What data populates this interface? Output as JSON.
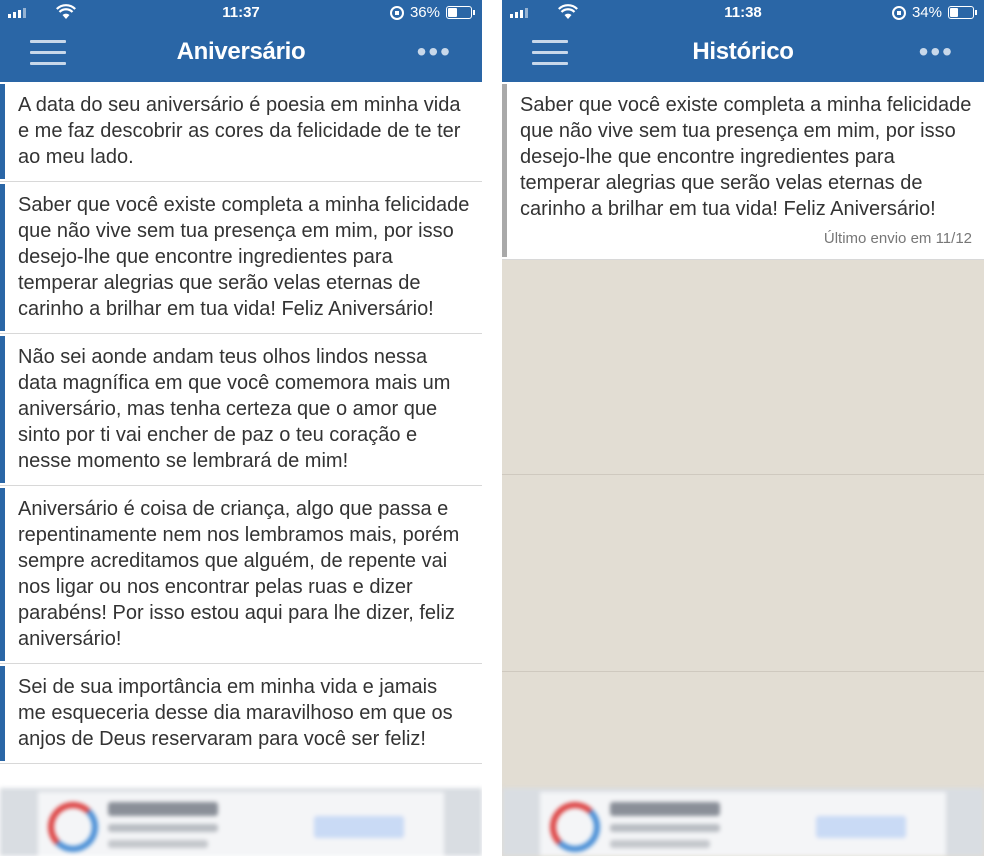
{
  "left": {
    "status": {
      "time": "11:37",
      "battery": "36%",
      "battery_level": 0.36
    },
    "title": "Aniversário",
    "messages": [
      "A data do seu aniversário é poesia em minha vida e me faz descobrir as cores da felicidade de te ter ao meu lado.",
      "Saber que você existe completa a minha felicidade que não vive sem tua presença em mim, por isso desejo-lhe que encontre ingredientes para temperar alegrias que serão velas eternas de carinho a brilhar em tua vida! Feliz Aniversário!",
      "Não sei aonde andam teus olhos lindos nessa data magnífica em que você comemora mais um aniversário, mas tenha certeza que o amor que sinto por ti vai encher de paz o teu coração e nesse momento se lembrará de mim!",
      "Aniversário é coisa de criança, algo que passa e repentinamente nem nos lembramos mais, porém sempre acreditamos que alguém, de repente vai nos ligar ou nos encontrar pelas ruas e dizer parabéns! Por isso estou aqui para lhe dizer, feliz aniversário!",
      "Sei de sua importância em minha vida e jamais me esqueceria desse dia maravilhoso em que os anjos de Deus reservaram para você ser feliz!"
    ]
  },
  "right": {
    "status": {
      "time": "11:38",
      "battery": "34%",
      "battery_level": 0.34
    },
    "title": "Histórico",
    "history": {
      "message": "Saber que você existe completa a minha felicidade que não vive sem tua presença em mim, por isso desejo-lhe que encontre ingredientes para temperar alegrias que serão velas eternas de carinho a brilhar em tua vida! Feliz Aniversário!",
      "last_sent": "Último envio em 11/12"
    }
  },
  "colors": {
    "app_bar": "#2a66a6",
    "accent_bar": "#2a66a6",
    "history_accent": "#a9a9a9",
    "empty_bg": "#e2ddd3"
  },
  "icons": {
    "menu": "hamburger-menu-icon",
    "more": "more-dots-icon",
    "signal": "signal-icon",
    "wifi": "wifi-icon",
    "orientation_lock": "orientation-lock-icon",
    "battery": "battery-icon"
  }
}
